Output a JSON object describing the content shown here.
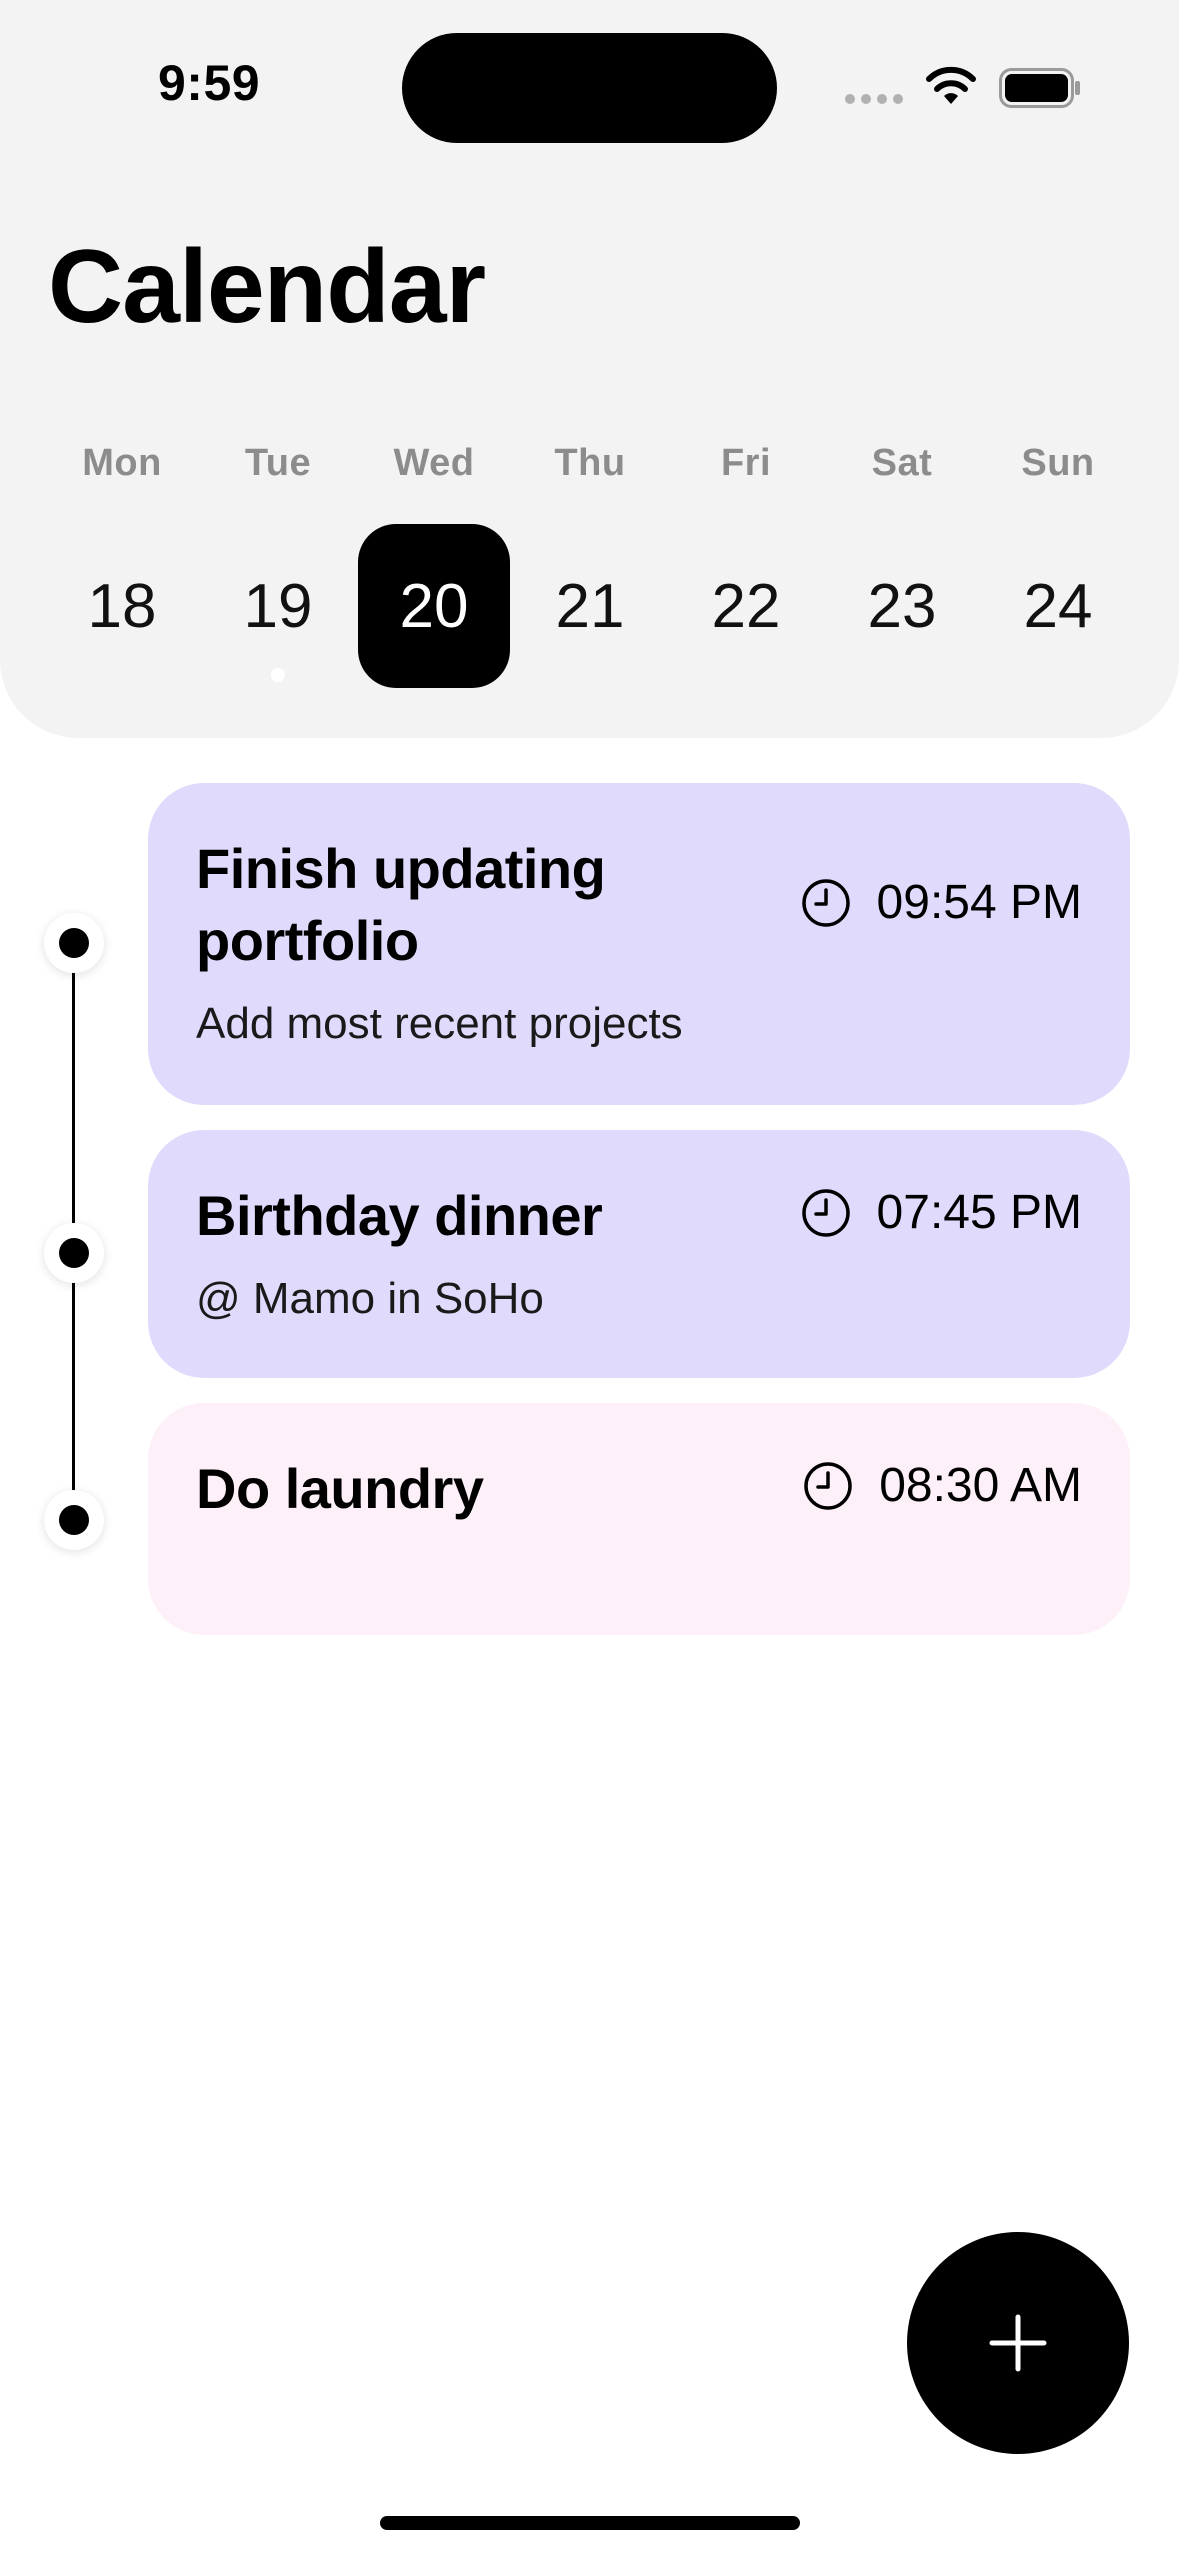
{
  "status_bar": {
    "time": "9:59"
  },
  "header": {
    "title": "Calendar"
  },
  "week": {
    "days": [
      {
        "name": "Mon",
        "date": "18"
      },
      {
        "name": "Tue",
        "date": "19"
      },
      {
        "name": "Wed",
        "date": "20"
      },
      {
        "name": "Thu",
        "date": "21"
      },
      {
        "name": "Fri",
        "date": "22"
      },
      {
        "name": "Sat",
        "date": "23"
      },
      {
        "name": "Sun",
        "date": "24"
      }
    ],
    "selected_date": "20",
    "dates_with_events": [
      "19"
    ]
  },
  "events": [
    {
      "title": "Finish updating portfolio",
      "subtitle": "Add most recent projects",
      "time": "09:54 PM",
      "color": "#e0dbfc",
      "icon": "clock-icon"
    },
    {
      "title": "Birthday dinner",
      "subtitle": "@ Mamo in SoHo",
      "time": "07:45 PM",
      "color": "#e0dbfc",
      "icon": "clock-icon"
    },
    {
      "title": "Do laundry",
      "subtitle": "",
      "time": "08:30 AM",
      "color": "#fdf0f8",
      "icon": "clock-icon"
    }
  ],
  "fab": {
    "icon": "plus-icon"
  },
  "colors": {
    "accent": "#000000",
    "header_bg": "#f3f3f3",
    "muted_text": "#8c8c8c"
  }
}
